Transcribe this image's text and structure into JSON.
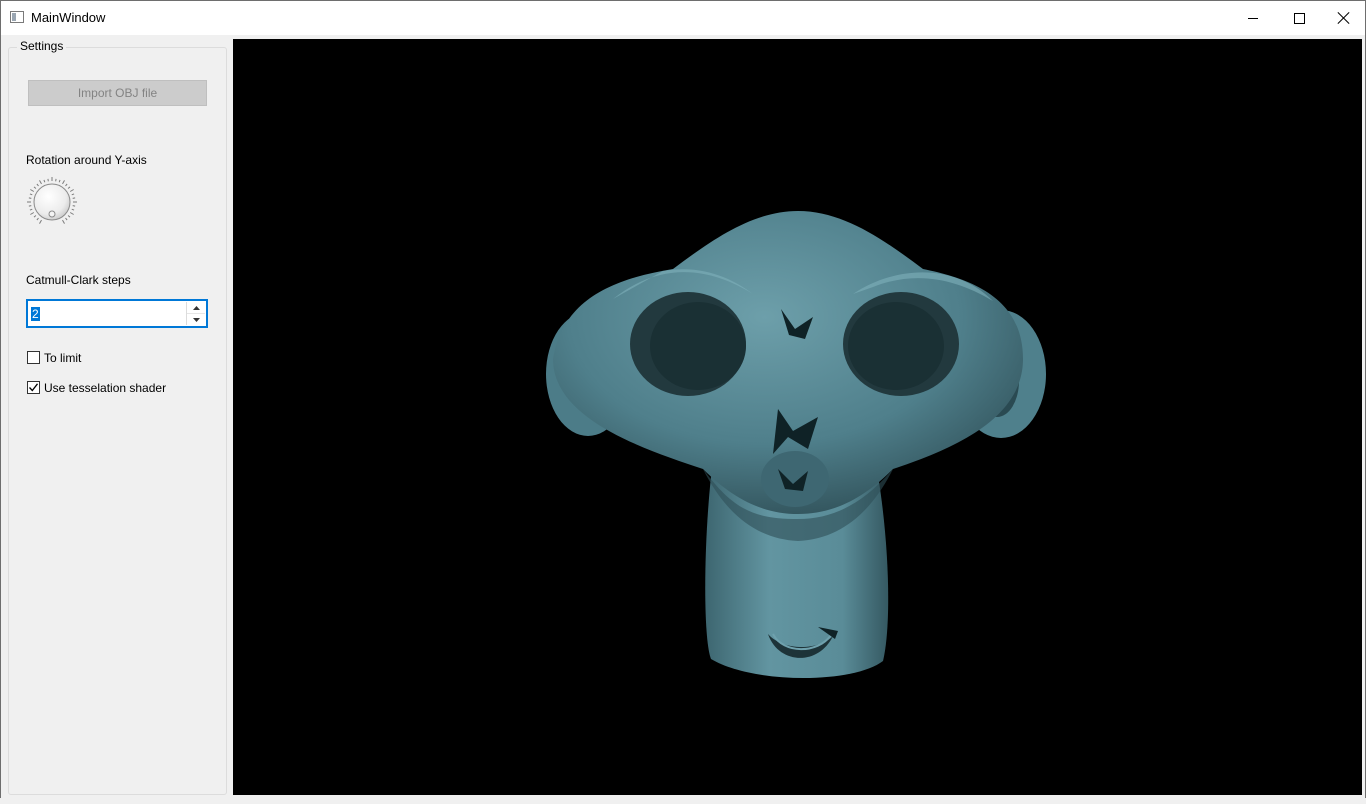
{
  "window": {
    "title": "MainWindow",
    "minimize_label": "Minimize",
    "maximize_label": "Maximize",
    "close_label": "Close"
  },
  "settings": {
    "group_title": "Settings",
    "import_button": "Import OBJ file",
    "rotation_label": "Rotation around Y-axis",
    "catmull_label": "Catmull-Clark steps",
    "catmull_value": "2",
    "to_limit_label": "To limit",
    "to_limit_checked": false,
    "tessellation_label": "Use tesselation shader",
    "tessellation_checked": true
  },
  "colors": {
    "viewport_bg": "#000000",
    "model_color": "#5a8c98",
    "accent": "#0078d7"
  },
  "icons": {
    "app": "window-app-icon",
    "minimize": "minimize-icon",
    "maximize": "maximize-icon",
    "close": "close-icon",
    "spin_up": "chevron-up-icon",
    "spin_down": "chevron-down-icon",
    "check": "checkmark-icon"
  }
}
